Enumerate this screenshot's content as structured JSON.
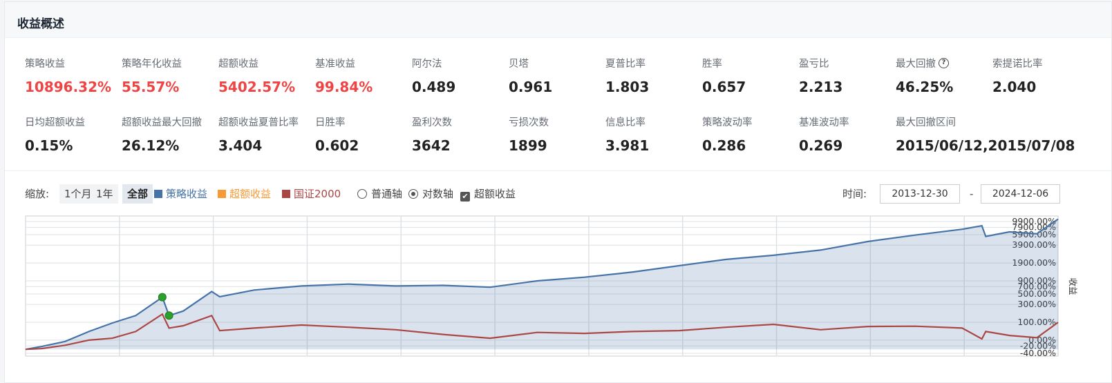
{
  "header": {
    "title": "收益概述"
  },
  "metrics_row1": [
    {
      "label": "策略收益",
      "value": "10896.32%",
      "highlight": true
    },
    {
      "label": "策略年化收益",
      "value": "55.57%",
      "highlight": true
    },
    {
      "label": "超额收益",
      "value": "5402.57%",
      "highlight": true
    },
    {
      "label": "基准收益",
      "value": "99.84%",
      "highlight": true
    },
    {
      "label": "阿尔法",
      "value": "0.489",
      "highlight": false
    },
    {
      "label": "贝塔",
      "value": "0.961",
      "highlight": false
    },
    {
      "label": "夏普比率",
      "value": "1.803",
      "highlight": false
    },
    {
      "label": "胜率",
      "value": "0.657",
      "highlight": false
    },
    {
      "label": "盈亏比",
      "value": "2.213",
      "highlight": false
    },
    {
      "label": "最大回撤",
      "value": "46.25%",
      "highlight": false,
      "help": "?"
    },
    {
      "label": "索提诺比率",
      "value": "2.040",
      "highlight": false
    }
  ],
  "metrics_row2": [
    {
      "label": "日均超额收益",
      "value": "0.15%"
    },
    {
      "label": "超额收益最大回撤",
      "value": "26.12%"
    },
    {
      "label": "超额收益夏普比率",
      "value": "3.404"
    },
    {
      "label": "日胜率",
      "value": "0.602"
    },
    {
      "label": "盈利次数",
      "value": "3642"
    },
    {
      "label": "亏损次数",
      "value": "1899"
    },
    {
      "label": "信息比率",
      "value": "3.981"
    },
    {
      "label": "策略波动率",
      "value": "0.286"
    },
    {
      "label": "基准波动率",
      "value": "0.269"
    },
    {
      "label": "最大回撤区间",
      "value": "2015/06/12,2015/07/08"
    }
  ],
  "toolbar": {
    "zoom_label": "缩放:",
    "zoom_options": [
      "1个月",
      "1年",
      "全部"
    ],
    "zoom_active": "全部",
    "legend": [
      {
        "name": "策略收益",
        "color": "#4572a7"
      },
      {
        "name": "超额收益",
        "color": "#f79a35"
      },
      {
        "name": "国证2000",
        "color": "#aa4643"
      }
    ],
    "axis_normal": "普通轴",
    "axis_log": "对数轴",
    "axis_selected": "对数轴",
    "excess_checkbox": "超额收益",
    "excess_checked": true,
    "time_label": "时间:",
    "date_from": "2013-12-30",
    "date_sep": "-",
    "date_to": "2024-12-06"
  },
  "chart_data": {
    "type": "line",
    "y_scale": "log",
    "ylabel": "收益",
    "yticks": [
      "9900.00%",
      "7900.00%",
      "5900.00%",
      "3900.00%",
      "1900.00%",
      "900.00%",
      "700.00%",
      "500.00%",
      "300.00%",
      "100.00%",
      "0.00%",
      "-20.00%",
      "-40.00%"
    ],
    "ytick_values": [
      9900,
      7900,
      5900,
      3900,
      1900,
      900,
      700,
      500,
      300,
      100,
      0,
      -20,
      -40
    ],
    "x_range": [
      "2013-12-30",
      "2024-12-06"
    ],
    "series": [
      {
        "name": "策略收益",
        "color": "#4572a7",
        "area": true,
        "points": [
          [
            "2013-12-30",
            -30
          ],
          [
            "2014-03-01",
            -22
          ],
          [
            "2014-06-01",
            -5
          ],
          [
            "2014-09-01",
            40
          ],
          [
            "2014-12-01",
            95
          ],
          [
            "2015-03-01",
            160
          ],
          [
            "2015-06-12",
            430
          ],
          [
            "2015-07-08",
            160
          ],
          [
            "2015-09-01",
            210
          ],
          [
            "2015-12-20",
            560
          ],
          [
            "2016-01-20",
            440
          ],
          [
            "2016-06-01",
            600
          ],
          [
            "2016-12-01",
            720
          ],
          [
            "2017-06-01",
            780
          ],
          [
            "2017-12-01",
            720
          ],
          [
            "2018-06-01",
            740
          ],
          [
            "2018-12-01",
            680
          ],
          [
            "2019-06-01",
            900
          ],
          [
            "2019-12-01",
            1050
          ],
          [
            "2020-06-01",
            1300
          ],
          [
            "2020-12-01",
            1700
          ],
          [
            "2021-06-01",
            2200
          ],
          [
            "2021-12-01",
            2600
          ],
          [
            "2022-06-01",
            3200
          ],
          [
            "2022-12-01",
            4500
          ],
          [
            "2023-06-01",
            5800
          ],
          [
            "2023-12-01",
            7300
          ],
          [
            "2024-02-15",
            8400
          ],
          [
            "2024-03-01",
            5500
          ],
          [
            "2024-06-01",
            6600
          ],
          [
            "2024-09-15",
            6100
          ],
          [
            "2024-12-06",
            10896
          ]
        ]
      },
      {
        "name": "国证2000",
        "color": "#aa4643",
        "area": false,
        "points": [
          [
            "2013-12-30",
            -30
          ],
          [
            "2014-03-01",
            -28
          ],
          [
            "2014-06-01",
            -18
          ],
          [
            "2014-09-01",
            0
          ],
          [
            "2014-12-01",
            8
          ],
          [
            "2015-03-01",
            40
          ],
          [
            "2015-06-12",
            175
          ],
          [
            "2015-07-08",
            60
          ],
          [
            "2015-09-01",
            75
          ],
          [
            "2015-12-20",
            160
          ],
          [
            "2016-01-20",
            45
          ],
          [
            "2016-06-01",
            60
          ],
          [
            "2016-12-01",
            80
          ],
          [
            "2017-06-01",
            65
          ],
          [
            "2017-12-01",
            50
          ],
          [
            "2018-06-01",
            25
          ],
          [
            "2018-12-01",
            8
          ],
          [
            "2019-06-01",
            35
          ],
          [
            "2019-12-01",
            30
          ],
          [
            "2020-06-01",
            40
          ],
          [
            "2020-12-01",
            45
          ],
          [
            "2021-06-01",
            65
          ],
          [
            "2021-12-01",
            85
          ],
          [
            "2022-06-01",
            50
          ],
          [
            "2022-12-01",
            70
          ],
          [
            "2023-06-01",
            72
          ],
          [
            "2023-12-01",
            60
          ],
          [
            "2024-02-15",
            5
          ],
          [
            "2024-03-01",
            40
          ],
          [
            "2024-06-01",
            20
          ],
          [
            "2024-09-15",
            10
          ],
          [
            "2024-12-06",
            99.84
          ]
        ]
      }
    ],
    "markers": [
      {
        "label": "最大回撤开始",
        "date": "2015-06-12",
        "value": 430,
        "color": "#2ca02c"
      },
      {
        "label": "最大回撤结束",
        "date": "2015-07-08",
        "value": 160,
        "color": "#2ca02c"
      }
    ],
    "grid": true
  }
}
